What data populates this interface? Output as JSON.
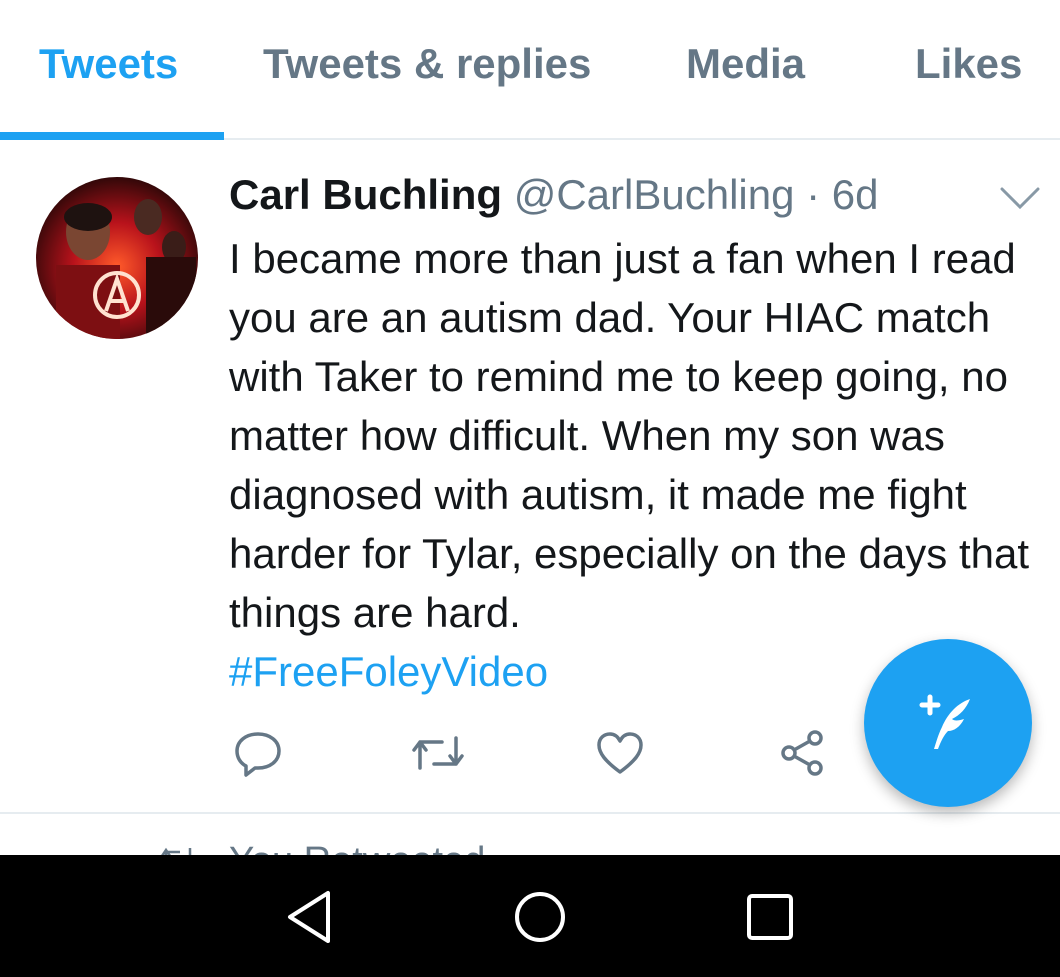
{
  "tabs": [
    {
      "label": "Tweets",
      "active": true
    },
    {
      "label": "Tweets & replies",
      "active": false
    },
    {
      "label": "Media",
      "active": false
    },
    {
      "label": "Likes",
      "active": false
    }
  ],
  "tweet": {
    "name": "Carl Buchling",
    "handle": "@CarlBuchling",
    "time": " · 6d",
    "text": "I became more than just a fan when I read you are an autism dad. Your HIAC match with Taker to remind me to keep going, no matter how difficult. When my son was diagnosed with autism, it made me fight harder for Tylar, especially on the days that things are hard.",
    "hashtag": "#FreeFoleyVideo",
    "actions": [
      "reply-icon",
      "retweet-icon",
      "like-icon",
      "share-icon"
    ]
  },
  "next_row": {
    "text": "You Retweeted"
  },
  "fab": {
    "icon": "compose-tweet-icon"
  },
  "nav": [
    "back-icon",
    "home-icon",
    "recents-icon"
  ],
  "colors": {
    "accent": "#1da1f2",
    "secondary_text": "#657786",
    "primary_text": "#14171a"
  }
}
